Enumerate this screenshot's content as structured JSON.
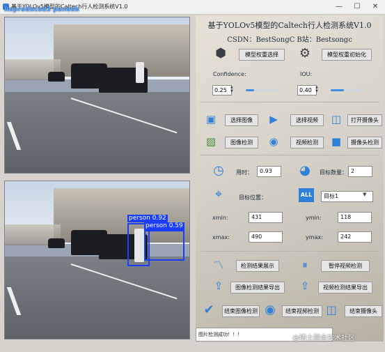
{
  "window": {
    "title": "基于YOLOv5模型的Caltech行人检测系统V1.0",
    "overlay_logo": "Reproduced3 paneeb",
    "controls": {
      "minimize": "—",
      "maximize": "☐",
      "close": "✕"
    }
  },
  "header": {
    "title": "基于YOLOv5模型的Caltech行人检测系统V1.0",
    "subtitle": "CSDN：BestSongC   B站：Bestsongc"
  },
  "model": {
    "select_weights_label": "模型权重选择",
    "init_weights_label": "模型权重初始化",
    "confidence_label": "Confidence:",
    "confidence_value": "0.25",
    "confidence_fraction": 0.25,
    "iou_label": "IOU:",
    "iou_value": "0.40",
    "iou_fraction": 0.4
  },
  "actions": {
    "select_image": "选择图像",
    "select_video": "选择视频",
    "open_camera": "打开摄像头",
    "image_detect": "图像检测",
    "video_detect": "视频检测",
    "camera_detect": "摄像头检测"
  },
  "results": {
    "time_label": "用时：",
    "time_value": "0.93",
    "count_label": "目标数量：",
    "count_value": "2",
    "position_label": "目标位置：",
    "target_select": "目标1",
    "xmin_label": "xmin:",
    "xmin_value": "431",
    "ymin_label": "ymin:",
    "ymin_value": "118",
    "xmax_label": "xmax:",
    "xmax_value": "490",
    "ymax_label": "ymax:",
    "ymax_value": "242"
  },
  "bottom_actions": {
    "show_results": "检测结果展示",
    "pause_video": "暂停视频检测",
    "export_image": "图像检测结果导出",
    "export_video": "视频检测结果导出",
    "end_image": "结束图像检测",
    "end_video": "结束视频检测",
    "end_camera": "结束摄像头"
  },
  "detections": [
    {
      "label": "person 0.92"
    },
    {
      "label": "person 0.59"
    }
  ],
  "status": "图片检测成功！！！",
  "watermark": "@稀土掘金技术社区",
  "colors": {
    "accent": "#3d8ee8",
    "detection_box": "#1a3dff",
    "icon_blue": "#2f80d8"
  }
}
